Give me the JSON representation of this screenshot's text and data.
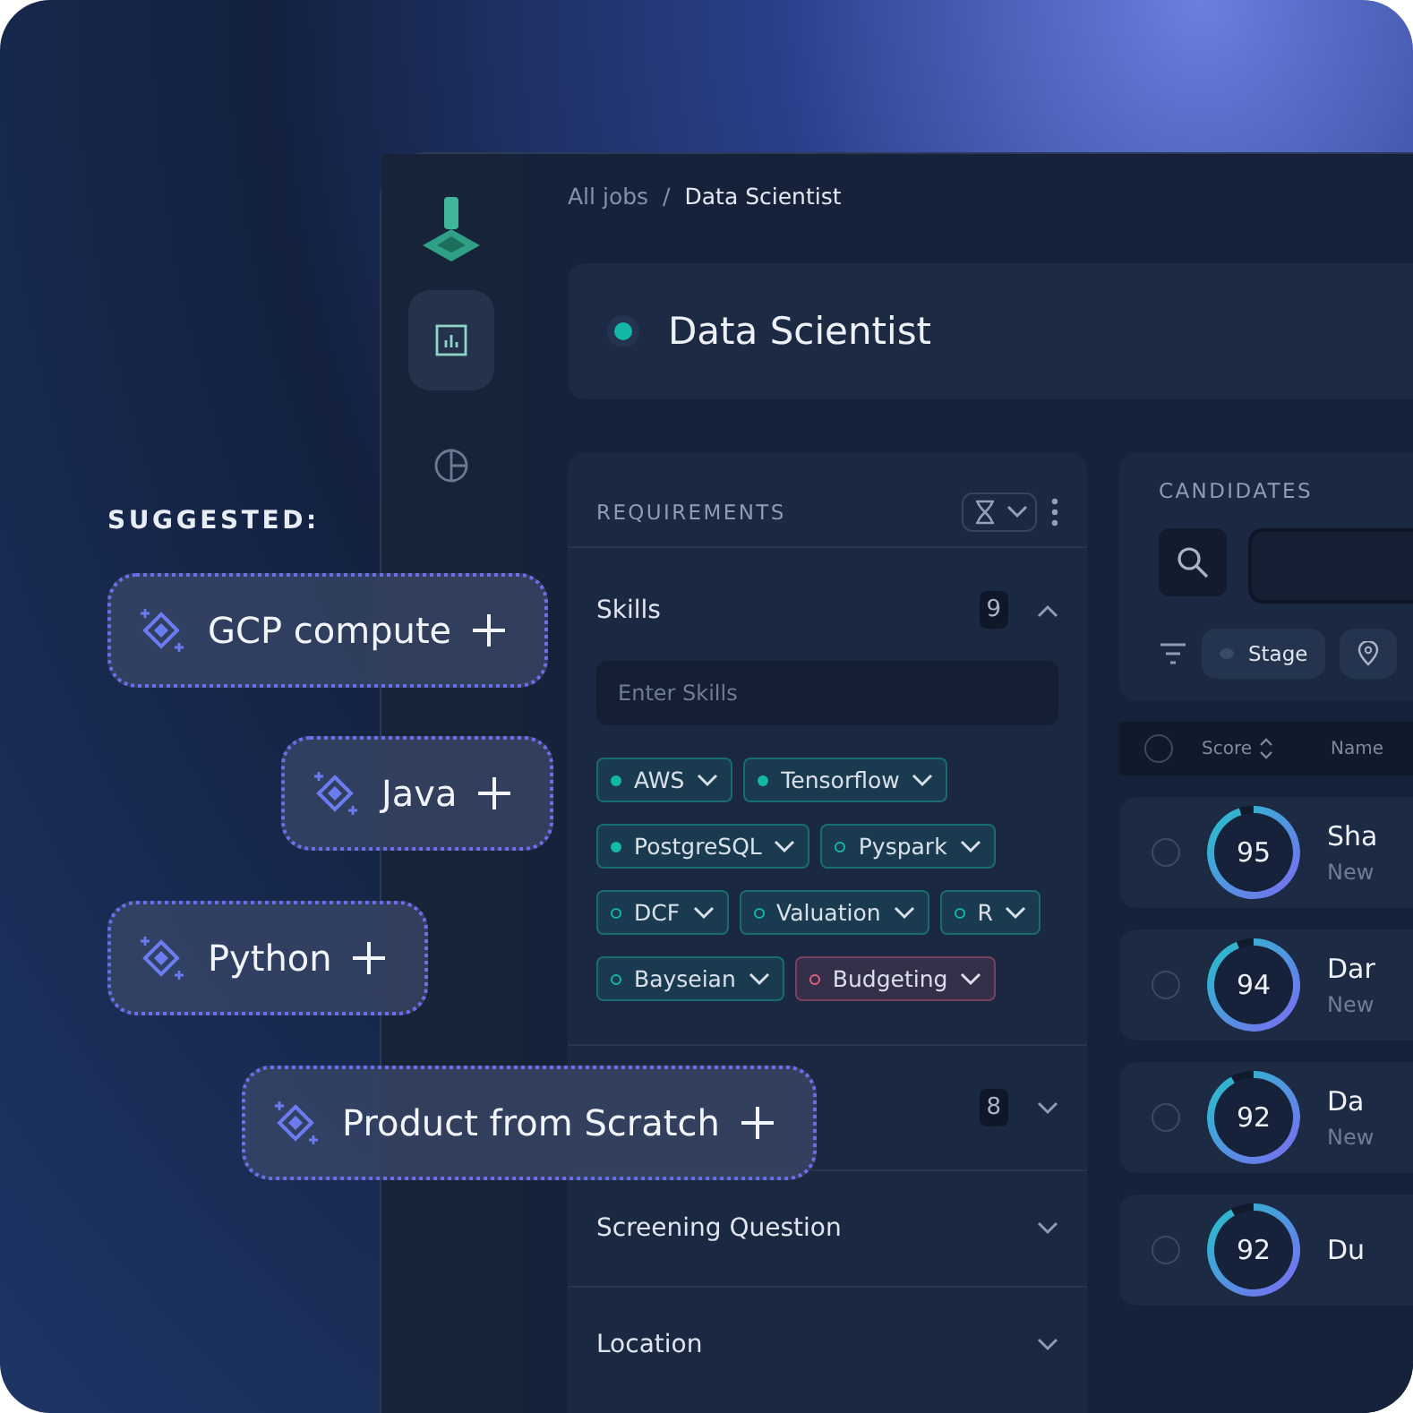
{
  "breadcrumb": {
    "parent": "All jobs",
    "separator": "/",
    "current": "Data Scientist"
  },
  "sidebar": {
    "items": [
      {
        "selected": true
      },
      {
        "selected": false
      }
    ]
  },
  "job": {
    "title": "Data Scientist"
  },
  "requirements": {
    "title": "REQUIREMENTS",
    "sections": [
      {
        "title": "Skills",
        "count": "9",
        "expanded": true,
        "placeholder": "Enter Skills",
        "tags": [
          {
            "label": "AWS",
            "kind": "filled",
            "color": "#14b8a6"
          },
          {
            "label": "Tensorflow",
            "kind": "filled",
            "color": "#14b8a6"
          },
          {
            "label": "PostgreSQL",
            "kind": "filled",
            "color": "#14b8a6"
          },
          {
            "label": "Pyspark",
            "kind": "ring",
            "color": "#14b8a6"
          },
          {
            "label": "DCF",
            "kind": "ring",
            "color": "#14b8a6"
          },
          {
            "label": "Valuation",
            "kind": "ring",
            "color": "#14b8a6"
          },
          {
            "label": "R",
            "kind": "ring",
            "color": "#14b8a6"
          },
          {
            "label": "Bayseian",
            "kind": "ring",
            "color": "#14b8a6"
          },
          {
            "label": "Budgeting",
            "kind": "ring",
            "color": "#e0607e"
          }
        ]
      },
      {
        "count": "8",
        "expanded": false
      },
      {
        "title": "Screening Question",
        "expanded": false
      },
      {
        "title": "Location",
        "expanded": false
      }
    ]
  },
  "candidates": {
    "title": "CANDIDATES",
    "filters": [
      {
        "label": "Stage",
        "kind": "stage"
      },
      {
        "kind": "location"
      }
    ],
    "columns": [
      "Score",
      "Name"
    ],
    "all_selected": false,
    "rows": [
      {
        "selected": false,
        "score": "95",
        "level": 0.95,
        "name": "Sha",
        "detail": "New"
      },
      {
        "selected": false,
        "score": "94",
        "level": 0.94,
        "name": "Dar",
        "detail": "New"
      },
      {
        "selected": false,
        "score": "92",
        "level": 0.92,
        "name": "Da",
        "detail": "New"
      },
      {
        "selected": false,
        "score": "92",
        "level": 0.92,
        "name": "Du"
      }
    ]
  },
  "suggested": {
    "title": "SUGGESTED:",
    "items": [
      "GCP compute",
      "Java",
      "Python",
      "Product from Scratch"
    ]
  }
}
